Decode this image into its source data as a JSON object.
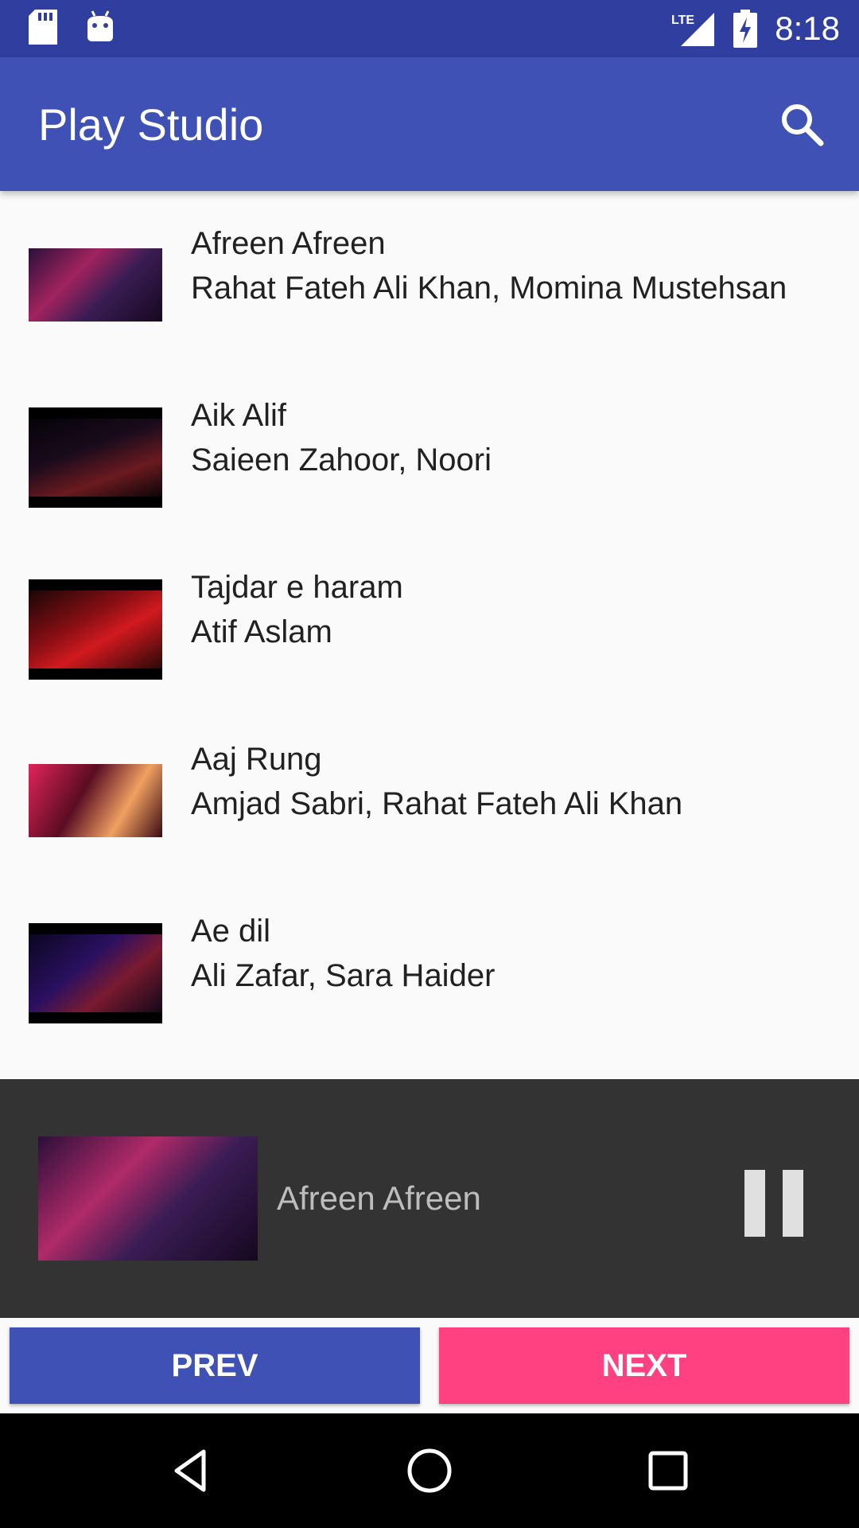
{
  "status_bar": {
    "time": "8:18",
    "network": "LTE",
    "icons": [
      "sd-card-icon",
      "android-icon",
      "signal-icon",
      "battery-charging-icon"
    ]
  },
  "app_bar": {
    "title": "Play Studio",
    "search_icon": "search-icon"
  },
  "songs": [
    {
      "title": "Afreen Afreen",
      "artist": "Rahat Fateh Ali Khan, Momina Mustehsan"
    },
    {
      "title": "Aik Alif",
      "artist": "Saieen Zahoor, Noori"
    },
    {
      "title": "Tajdar e haram",
      "artist": "Atif Aslam"
    },
    {
      "title": "Aaj Rung",
      "artist": "Amjad Sabri,  Rahat Fateh Ali Khan"
    },
    {
      "title": "Ae dil",
      "artist": "Ali Zafar, Sara Haider"
    }
  ],
  "now_playing": {
    "title": "Afreen Afreen",
    "control_icon": "pause-icon"
  },
  "controls": {
    "prev_label": "PREV",
    "next_label": "NEXT"
  },
  "colors": {
    "primary": "#3f51b5",
    "primary_dark": "#303f9f",
    "accent": "#ff4081",
    "player_bg": "#333333"
  },
  "nav_bar": {
    "icons": [
      "back-icon",
      "home-icon",
      "recents-icon"
    ]
  }
}
